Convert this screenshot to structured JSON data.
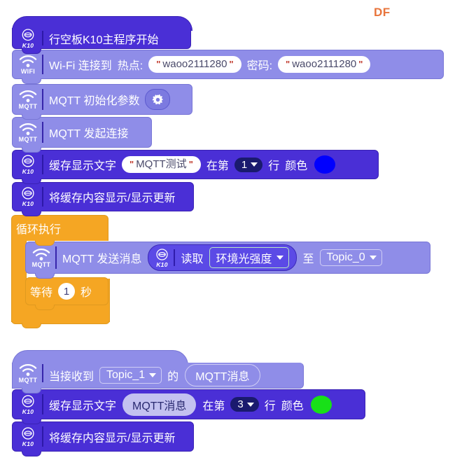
{
  "watermark": {
    "text": "DF"
  },
  "icons": {
    "k10": "k10-board-icon",
    "wifi": "wifi-icon",
    "mqtt": "mqtt-icon",
    "gear": "gear-icon",
    "caret": "chevron-down-icon"
  },
  "icon_labels": {
    "k10": "K10",
    "wifi": "WIFI",
    "mqtt": "MQTT"
  },
  "colors": {
    "k10_block": "#4a2fd6",
    "wifi_block": "#8f8de8",
    "mqtt_block": "#8f8de8",
    "inner_block": "#5b4ae6",
    "control_block": "#f5a623",
    "dropdown_dark": "#1a1a6e",
    "swatch_blue": "#0000fe",
    "swatch_green": "#18e018",
    "watermark": "#e8743b",
    "canvas": "#ffffff"
  },
  "script_main": {
    "hat": {
      "label": "行空板K10主程序开始"
    },
    "wifi_connect": {
      "label_1": "Wi-Fi 连接到",
      "label_2": "热点:",
      "ssid": "waoo2111280",
      "label_3": "密码:",
      "password": "waoo2111280",
      "quote": "\""
    },
    "mqtt_init": {
      "label": "MQTT 初始化参数"
    },
    "mqtt_connect": {
      "label": "MQTT 发起连接"
    },
    "display_text": {
      "label_1": "缓存显示文字",
      "value": "MQTT测试",
      "quote": "\"",
      "label_2": "在第",
      "line": "1",
      "label_3": "行",
      "label_4": "颜色",
      "color": "#0000fe"
    },
    "display_update": {
      "label": "将缓存内容显示/显示更新"
    },
    "loop": {
      "label": "循环执行",
      "mqtt_publish": {
        "label_1": "MQTT 发送消息",
        "reporter": {
          "label": "读取",
          "sensor": "环境光强度"
        },
        "label_2": "至",
        "topic": "Topic_0"
      },
      "wait": {
        "label_1": "等待",
        "seconds": "1",
        "label_2": "秒"
      }
    }
  },
  "script_event": {
    "hat": {
      "label_1": "当接收到",
      "topic": "Topic_1",
      "label_2": "的",
      "message": "MQTT消息"
    },
    "display_text": {
      "label_1": "缓存显示文字",
      "value": "MQTT消息",
      "label_2": "在第",
      "line": "3",
      "label_3": "行",
      "label_4": "颜色",
      "color": "#18e018"
    },
    "display_update": {
      "label": "将缓存内容显示/显示更新"
    }
  }
}
